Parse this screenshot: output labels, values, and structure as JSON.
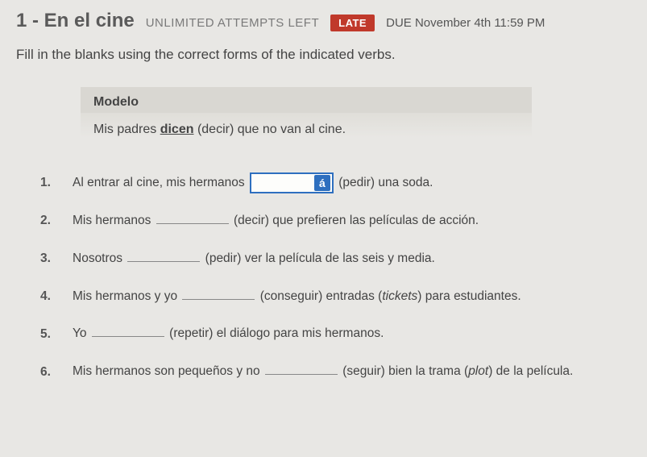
{
  "header": {
    "title": "1 - En el cine",
    "attempts": "UNLIMITED ATTEMPTS LEFT",
    "late_badge": "LATE",
    "due_label": "DUE",
    "due_value": "November 4th 11:59 PM"
  },
  "instructions": "Fill in the blanks using the correct forms of the indicated verbs.",
  "modelo": {
    "heading": "Modelo",
    "prefix": "Mis padres ",
    "answer": "dicen",
    "suffix": " (decir) que no van al cine."
  },
  "accent_button": "á",
  "questions": [
    {
      "num": "1.",
      "before": "Al entrar al cine, mis hermanos",
      "after_open": "(pedir) una soda.",
      "active": true
    },
    {
      "num": "2.",
      "before": "Mis hermanos",
      "after": "(decir) que prefieren las películas de acción."
    },
    {
      "num": "3.",
      "before": "Nosotros",
      "after": "(pedir) ver la película de las seis y media."
    },
    {
      "num": "4.",
      "before": "Mis hermanos y yo",
      "after_open": "(conseguir) entradas (",
      "italic": "tickets",
      "after_close": ") para estudiantes."
    },
    {
      "num": "5.",
      "before": "Yo",
      "after": "(repetir) el diálogo para mis hermanos."
    },
    {
      "num": "6.",
      "before": "Mis hermanos son pequeños y no",
      "after_open": "(seguir) bien la trama (",
      "italic": "plot",
      "after_close": ") de la película."
    }
  ]
}
